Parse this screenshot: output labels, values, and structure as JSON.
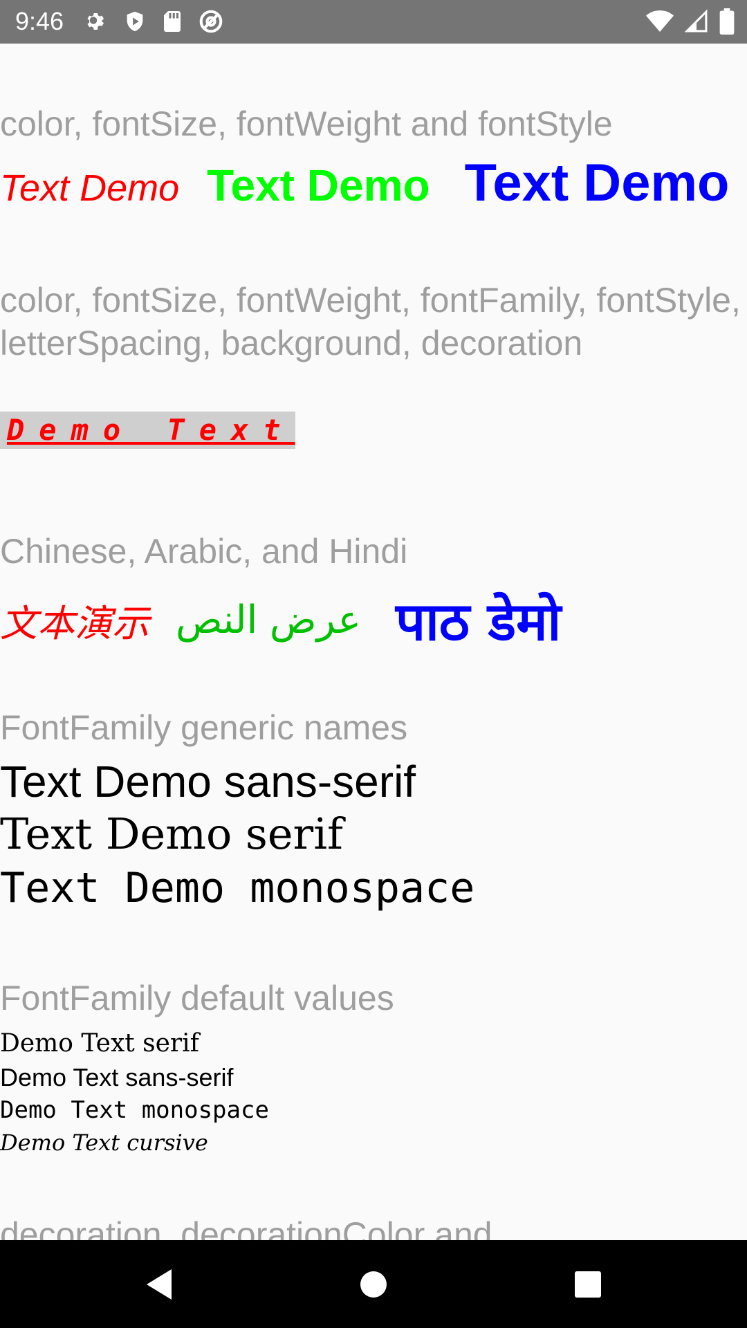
{
  "status_bar": {
    "time": "9:46",
    "left_icons": [
      "gear-icon",
      "shield-icon",
      "sd-card-icon",
      "at-sign-icon"
    ],
    "right_icons": [
      "wifi-icon",
      "signal-icon",
      "battery-icon"
    ]
  },
  "sections": {
    "s1": {
      "heading": "color, fontSize, fontWeight and fontStyle",
      "items": [
        {
          "text": "Text Demo",
          "color": "#ff0000"
        },
        {
          "text": "Text Demo",
          "color": "#00ff00"
        },
        {
          "text": "Text Demo",
          "color": "#0000ff"
        }
      ]
    },
    "s2": {
      "heading": "color, fontSize, fontWeight, fontFamily, fontStyle, letterSpacing, background, decoration",
      "text": "Demo Text",
      "color": "#ff0000",
      "background": "#cfcfcf"
    },
    "s3": {
      "heading": "Chinese, Arabic, and Hindi",
      "chinese": "文本演示",
      "arabic": "عرض النص",
      "hindi": "पाठ डेमो"
    },
    "s4": {
      "heading": "FontFamily generic names",
      "sans": "Text Demo sans-serif",
      "serif": "Text Demo serif",
      "mono": "Text Demo monospace"
    },
    "s5": {
      "heading": "FontFamily default values",
      "serif": "Demo Text serif",
      "sans": "Demo Text sans-serif",
      "mono": "Demo Text monospace",
      "cursive": "Demo Text cursive"
    },
    "s6": {
      "heading": "decoration, decorationColor and"
    }
  },
  "nav_bar": {
    "buttons": [
      "back-icon",
      "home-icon",
      "recents-icon"
    ]
  }
}
